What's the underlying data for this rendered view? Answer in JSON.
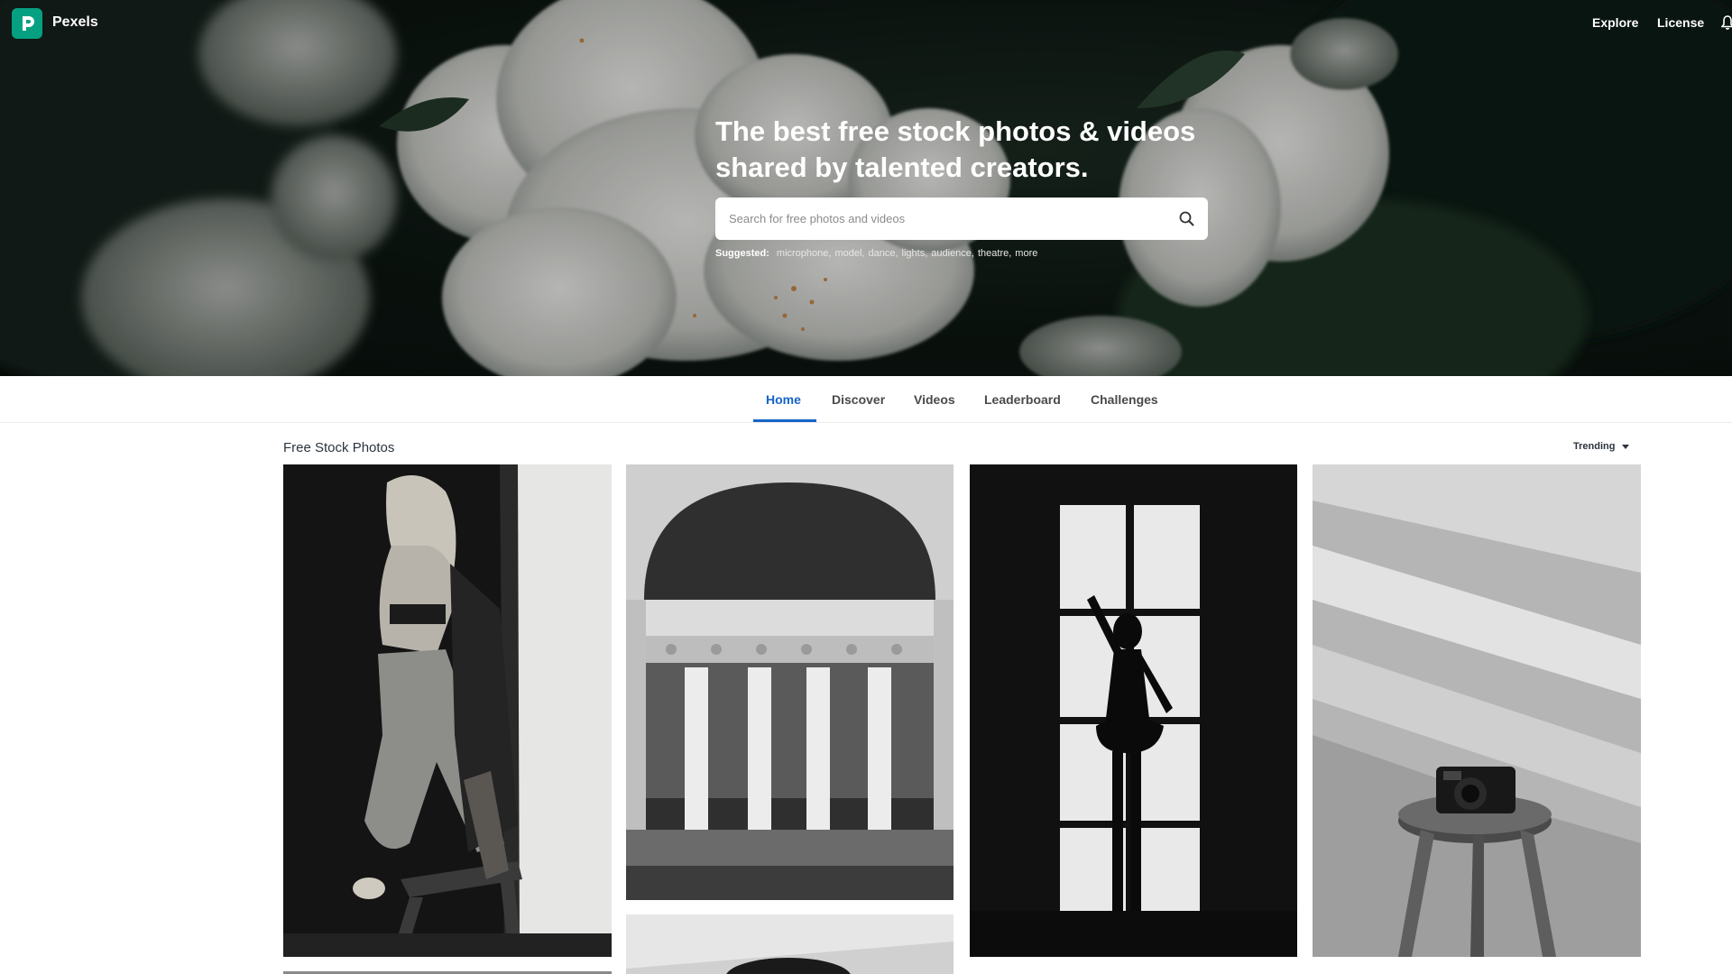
{
  "brand": {
    "name": "Pexels",
    "logo_letter": "P",
    "accent": "#05a081"
  },
  "header_nav": {
    "explore": "Explore",
    "license": "License"
  },
  "hero": {
    "title_line1": "The best free stock photos & videos",
    "title_line2": "shared by talented creators.",
    "search_placeholder": "Search for free photos and videos",
    "suggested_label": "Suggested:",
    "suggested_tags": [
      "microphone,",
      "model,",
      "dance,",
      "lights,",
      "audience,",
      "theatre,",
      "more"
    ]
  },
  "tabs": [
    {
      "label": "Home",
      "active": true
    },
    {
      "label": "Discover",
      "active": false
    },
    {
      "label": "Videos",
      "active": false
    },
    {
      "label": "Leaderboard",
      "active": false
    },
    {
      "label": "Challenges",
      "active": false
    }
  ],
  "gallery": {
    "title": "Free Stock Photos",
    "sort_label": "Trending"
  },
  "colors": {
    "active_tab": "#1664c7",
    "accent": "#05a081"
  }
}
